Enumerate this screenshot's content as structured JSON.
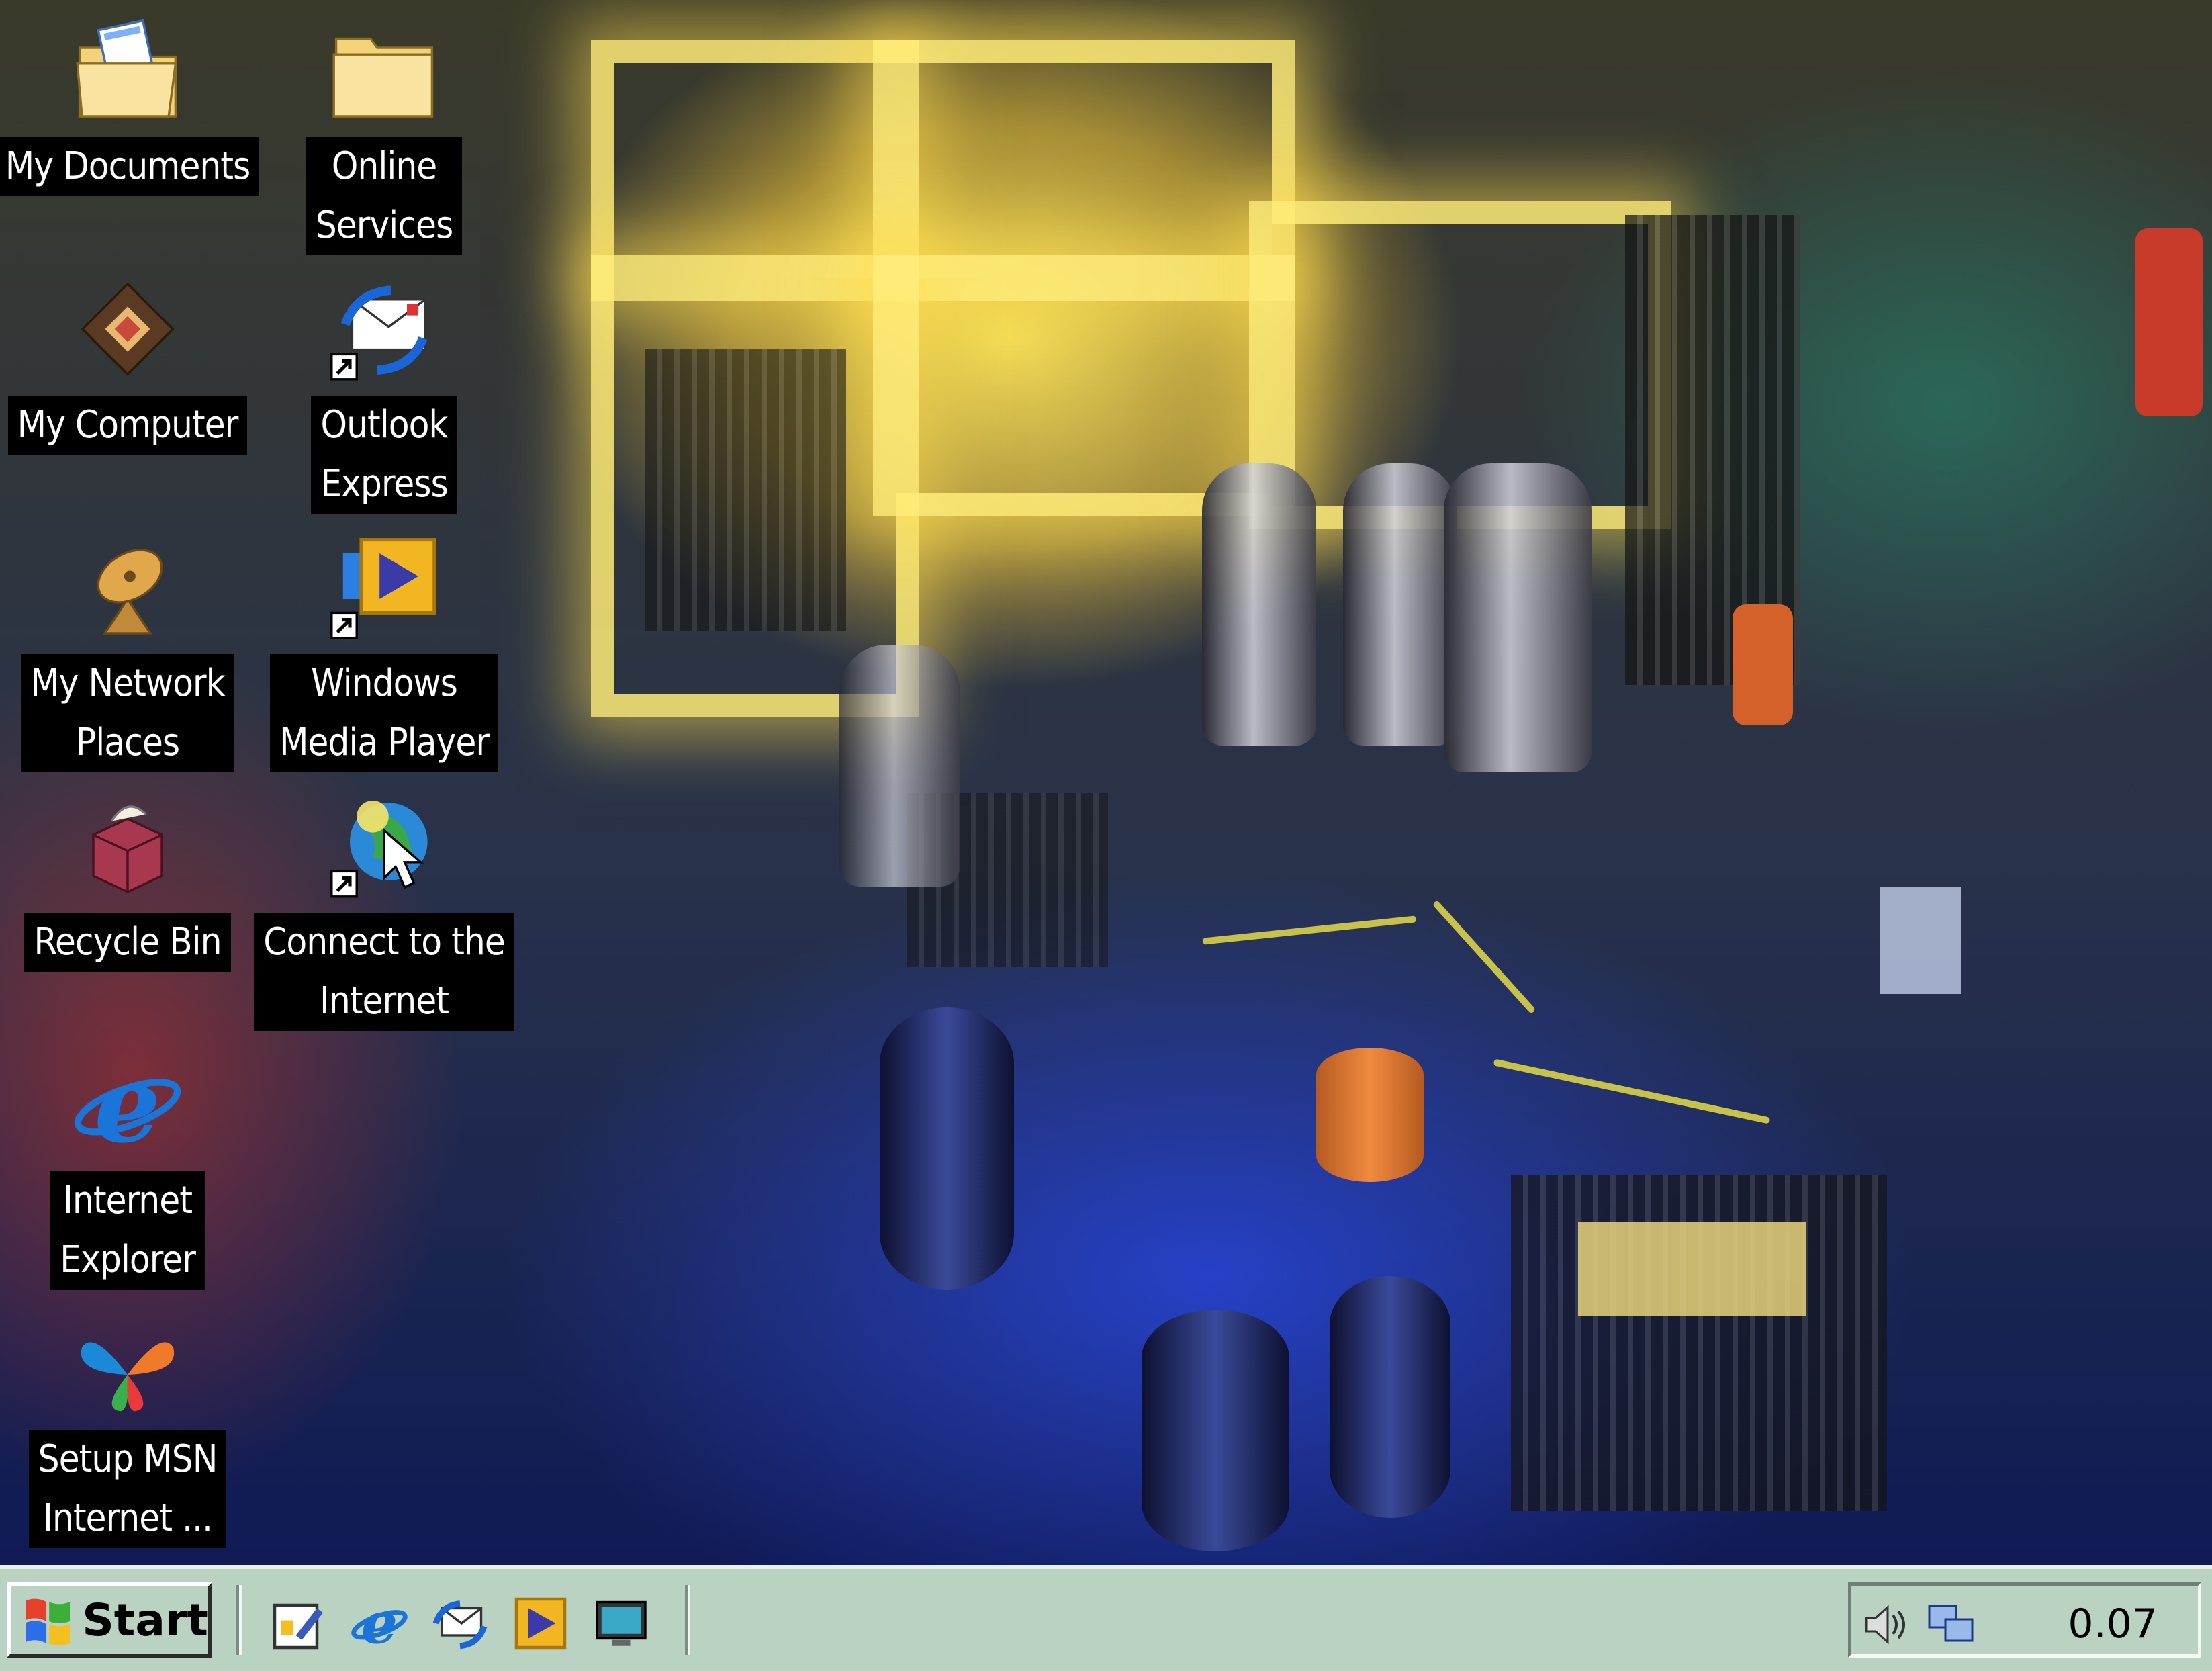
{
  "desktop": {
    "icons": [
      {
        "label": "My Documents",
        "icon": "my-documents-icon"
      },
      {
        "label": "Online\nServices",
        "icon": "folder-icon"
      },
      {
        "label": "My Computer",
        "icon": "my-computer-icon"
      },
      {
        "label": "Outlook\nExpress",
        "icon": "outlook-express-icon"
      },
      {
        "label": "My Network\nPlaces",
        "icon": "network-places-icon"
      },
      {
        "label": "Windows\nMedia Player",
        "icon": "media-player-icon"
      },
      {
        "label": "Recycle Bin",
        "icon": "recycle-bin-icon"
      },
      {
        "label": "Connect to the\nInternet",
        "icon": "connect-internet-icon"
      },
      {
        "label": "Internet\nExplorer",
        "icon": "internet-explorer-icon"
      },
      {
        "label": "Setup MSN\nInternet ...",
        "icon": "msn-butterfly-icon"
      }
    ]
  },
  "taskbar": {
    "start_label": "Start",
    "quick_launch": [
      "show-desktop-icon",
      "internet-explorer-icon",
      "outlook-express-icon",
      "media-player-icon",
      "desktop-monitor-icon"
    ],
    "tray": {
      "icons": [
        "speaker-icon",
        "network-connection-icon"
      ],
      "clock": "0.07"
    }
  },
  "colors": {
    "taskbar": "#b9d2c2",
    "label_bg": "#000000",
    "label_text": "#ffffff"
  }
}
